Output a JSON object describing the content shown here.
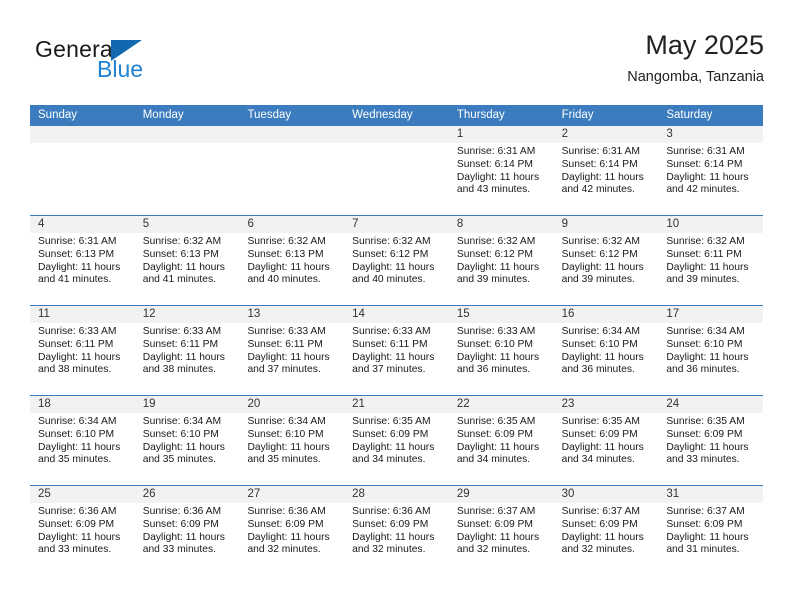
{
  "brand": {
    "name_top": "General",
    "name_bottom": "Blue",
    "triangle_color": "#1468b0",
    "blue_color": "#1f82d2"
  },
  "header": {
    "title": "May 2025",
    "subtitle": "Nangomba, Tanzania"
  },
  "theme": {
    "header_bg": "#3b7cbf",
    "header_text": "#ffffff",
    "daynum_band": "#f2f2f2",
    "rule_color": "#3b7cbf",
    "body_text": "#1a1a1a"
  },
  "weekdays": [
    "Sunday",
    "Monday",
    "Tuesday",
    "Wednesday",
    "Thursday",
    "Friday",
    "Saturday"
  ],
  "weeks": [
    [
      {
        "day": "",
        "sunrise": "",
        "sunset": "",
        "daylight": ""
      },
      {
        "day": "",
        "sunrise": "",
        "sunset": "",
        "daylight": ""
      },
      {
        "day": "",
        "sunrise": "",
        "sunset": "",
        "daylight": ""
      },
      {
        "day": "",
        "sunrise": "",
        "sunset": "",
        "daylight": ""
      },
      {
        "day": "1",
        "sunrise": "Sunrise: 6:31 AM",
        "sunset": "Sunset: 6:14 PM",
        "daylight": "Daylight: 11 hours and 43 minutes."
      },
      {
        "day": "2",
        "sunrise": "Sunrise: 6:31 AM",
        "sunset": "Sunset: 6:14 PM",
        "daylight": "Daylight: 11 hours and 42 minutes."
      },
      {
        "day": "3",
        "sunrise": "Sunrise: 6:31 AM",
        "sunset": "Sunset: 6:14 PM",
        "daylight": "Daylight: 11 hours and 42 minutes."
      }
    ],
    [
      {
        "day": "4",
        "sunrise": "Sunrise: 6:31 AM",
        "sunset": "Sunset: 6:13 PM",
        "daylight": "Daylight: 11 hours and 41 minutes."
      },
      {
        "day": "5",
        "sunrise": "Sunrise: 6:32 AM",
        "sunset": "Sunset: 6:13 PM",
        "daylight": "Daylight: 11 hours and 41 minutes."
      },
      {
        "day": "6",
        "sunrise": "Sunrise: 6:32 AM",
        "sunset": "Sunset: 6:13 PM",
        "daylight": "Daylight: 11 hours and 40 minutes."
      },
      {
        "day": "7",
        "sunrise": "Sunrise: 6:32 AM",
        "sunset": "Sunset: 6:12 PM",
        "daylight": "Daylight: 11 hours and 40 minutes."
      },
      {
        "day": "8",
        "sunrise": "Sunrise: 6:32 AM",
        "sunset": "Sunset: 6:12 PM",
        "daylight": "Daylight: 11 hours and 39 minutes."
      },
      {
        "day": "9",
        "sunrise": "Sunrise: 6:32 AM",
        "sunset": "Sunset: 6:12 PM",
        "daylight": "Daylight: 11 hours and 39 minutes."
      },
      {
        "day": "10",
        "sunrise": "Sunrise: 6:32 AM",
        "sunset": "Sunset: 6:11 PM",
        "daylight": "Daylight: 11 hours and 39 minutes."
      }
    ],
    [
      {
        "day": "11",
        "sunrise": "Sunrise: 6:33 AM",
        "sunset": "Sunset: 6:11 PM",
        "daylight": "Daylight: 11 hours and 38 minutes."
      },
      {
        "day": "12",
        "sunrise": "Sunrise: 6:33 AM",
        "sunset": "Sunset: 6:11 PM",
        "daylight": "Daylight: 11 hours and 38 minutes."
      },
      {
        "day": "13",
        "sunrise": "Sunrise: 6:33 AM",
        "sunset": "Sunset: 6:11 PM",
        "daylight": "Daylight: 11 hours and 37 minutes."
      },
      {
        "day": "14",
        "sunrise": "Sunrise: 6:33 AM",
        "sunset": "Sunset: 6:11 PM",
        "daylight": "Daylight: 11 hours and 37 minutes."
      },
      {
        "day": "15",
        "sunrise": "Sunrise: 6:33 AM",
        "sunset": "Sunset: 6:10 PM",
        "daylight": "Daylight: 11 hours and 36 minutes."
      },
      {
        "day": "16",
        "sunrise": "Sunrise: 6:34 AM",
        "sunset": "Sunset: 6:10 PM",
        "daylight": "Daylight: 11 hours and 36 minutes."
      },
      {
        "day": "17",
        "sunrise": "Sunrise: 6:34 AM",
        "sunset": "Sunset: 6:10 PM",
        "daylight": "Daylight: 11 hours and 36 minutes."
      }
    ],
    [
      {
        "day": "18",
        "sunrise": "Sunrise: 6:34 AM",
        "sunset": "Sunset: 6:10 PM",
        "daylight": "Daylight: 11 hours and 35 minutes."
      },
      {
        "day": "19",
        "sunrise": "Sunrise: 6:34 AM",
        "sunset": "Sunset: 6:10 PM",
        "daylight": "Daylight: 11 hours and 35 minutes."
      },
      {
        "day": "20",
        "sunrise": "Sunrise: 6:34 AM",
        "sunset": "Sunset: 6:10 PM",
        "daylight": "Daylight: 11 hours and 35 minutes."
      },
      {
        "day": "21",
        "sunrise": "Sunrise: 6:35 AM",
        "sunset": "Sunset: 6:09 PM",
        "daylight": "Daylight: 11 hours and 34 minutes."
      },
      {
        "day": "22",
        "sunrise": "Sunrise: 6:35 AM",
        "sunset": "Sunset: 6:09 PM",
        "daylight": "Daylight: 11 hours and 34 minutes."
      },
      {
        "day": "23",
        "sunrise": "Sunrise: 6:35 AM",
        "sunset": "Sunset: 6:09 PM",
        "daylight": "Daylight: 11 hours and 34 minutes."
      },
      {
        "day": "24",
        "sunrise": "Sunrise: 6:35 AM",
        "sunset": "Sunset: 6:09 PM",
        "daylight": "Daylight: 11 hours and 33 minutes."
      }
    ],
    [
      {
        "day": "25",
        "sunrise": "Sunrise: 6:36 AM",
        "sunset": "Sunset: 6:09 PM",
        "daylight": "Daylight: 11 hours and 33 minutes."
      },
      {
        "day": "26",
        "sunrise": "Sunrise: 6:36 AM",
        "sunset": "Sunset: 6:09 PM",
        "daylight": "Daylight: 11 hours and 33 minutes."
      },
      {
        "day": "27",
        "sunrise": "Sunrise: 6:36 AM",
        "sunset": "Sunset: 6:09 PM",
        "daylight": "Daylight: 11 hours and 32 minutes."
      },
      {
        "day": "28",
        "sunrise": "Sunrise: 6:36 AM",
        "sunset": "Sunset: 6:09 PM",
        "daylight": "Daylight: 11 hours and 32 minutes."
      },
      {
        "day": "29",
        "sunrise": "Sunrise: 6:37 AM",
        "sunset": "Sunset: 6:09 PM",
        "daylight": "Daylight: 11 hours and 32 minutes."
      },
      {
        "day": "30",
        "sunrise": "Sunrise: 6:37 AM",
        "sunset": "Sunset: 6:09 PM",
        "daylight": "Daylight: 11 hours and 32 minutes."
      },
      {
        "day": "31",
        "sunrise": "Sunrise: 6:37 AM",
        "sunset": "Sunset: 6:09 PM",
        "daylight": "Daylight: 11 hours and 31 minutes."
      }
    ]
  ]
}
